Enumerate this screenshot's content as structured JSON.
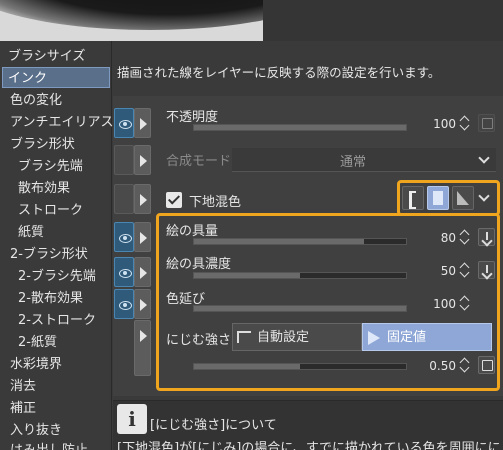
{
  "description": "描画された線をレイヤーに反映する際の設定を行います。",
  "sidebar": {
    "items": [
      {
        "label": "ブラシサイズ"
      },
      {
        "label": "インク"
      },
      {
        "label": "色の変化"
      },
      {
        "label": "アンチエイリアス"
      },
      {
        "label": "ブラシ形状"
      },
      {
        "label": "ブラシ先端"
      },
      {
        "label": "散布効果"
      },
      {
        "label": "ストローク"
      },
      {
        "label": "紙質"
      },
      {
        "label": "2-ブラシ形状"
      },
      {
        "label": "2-ブラシ先端"
      },
      {
        "label": "2-散布効果"
      },
      {
        "label": "2-ストローク"
      },
      {
        "label": "2-紙質"
      },
      {
        "label": "水彩境界"
      },
      {
        "label": "消去"
      },
      {
        "label": "補正"
      },
      {
        "label": "入り抜き"
      },
      {
        "label": "はみ出し防止"
      }
    ],
    "active_index": 1
  },
  "settings": {
    "opacity": {
      "label": "不透明度",
      "value": "100",
      "fill": 1.0
    },
    "blend_mode": {
      "label": "合成モード",
      "value": "通常"
    },
    "color_mixing": {
      "label": "下地混色",
      "checked": true
    },
    "amount_of_paint": {
      "label": "絵の具量",
      "value": "80",
      "fill": 0.8
    },
    "density_of_paint": {
      "label": "絵の具濃度",
      "value": "50",
      "fill": 0.5
    },
    "color_stretch": {
      "label": "色延び",
      "value": "100",
      "fill": 1.0
    },
    "blur_strength": {
      "label": "にじむ強さ",
      "auto_label": "自動設定",
      "fixed_label": "固定値",
      "value": "0.50",
      "fill": 0.5
    }
  },
  "info": {
    "icon": "info-icon",
    "title": "[にじむ強さ]について",
    "body": "[下地混色]が[にじみ]の場合に、すでに描かれている色を周囲にに"
  },
  "colors": {
    "highlight": "#f0a51e",
    "active_blue": "#8ea7d6",
    "sidebar_active": "#5a6f8a"
  }
}
